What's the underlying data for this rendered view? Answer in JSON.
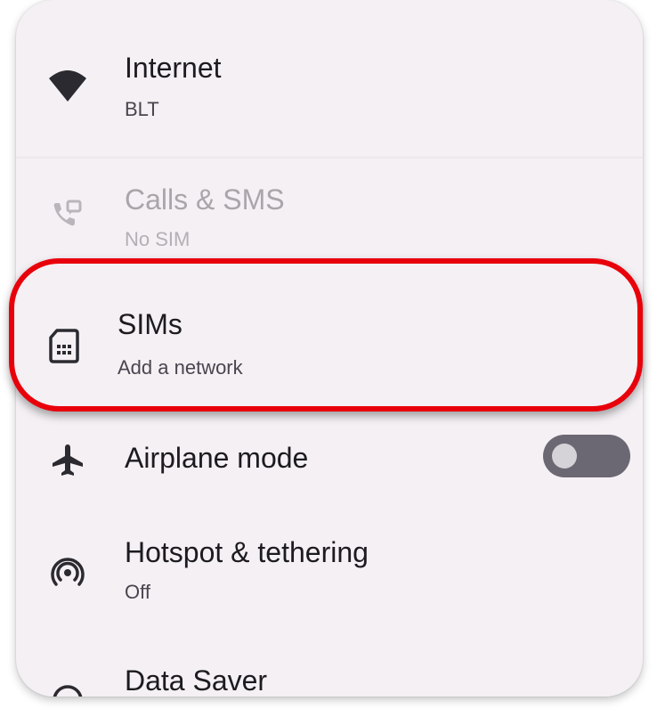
{
  "settings": {
    "internet": {
      "title": "Internet",
      "subtitle": "BLT",
      "icon": "wifi-icon"
    },
    "calls_sms": {
      "title": "Calls & SMS",
      "subtitle": "No SIM",
      "icon": "calls-sms-icon",
      "disabled": true
    },
    "sims": {
      "title": "SIMs",
      "subtitle": "Add a network",
      "icon": "sim-card-icon",
      "highlighted": true
    },
    "airplane_mode": {
      "title": "Airplane mode",
      "icon": "airplane-icon",
      "toggle_on": false
    },
    "hotspot": {
      "title": "Hotspot & tethering",
      "subtitle": "Off",
      "icon": "hotspot-icon"
    },
    "data_saver": {
      "title": "Data Saver",
      "icon": "data-saver-icon"
    }
  },
  "colors": {
    "highlight_border": "#e8000b",
    "background": "#f4f0f4",
    "toggle_track_off": "#6b6873"
  }
}
